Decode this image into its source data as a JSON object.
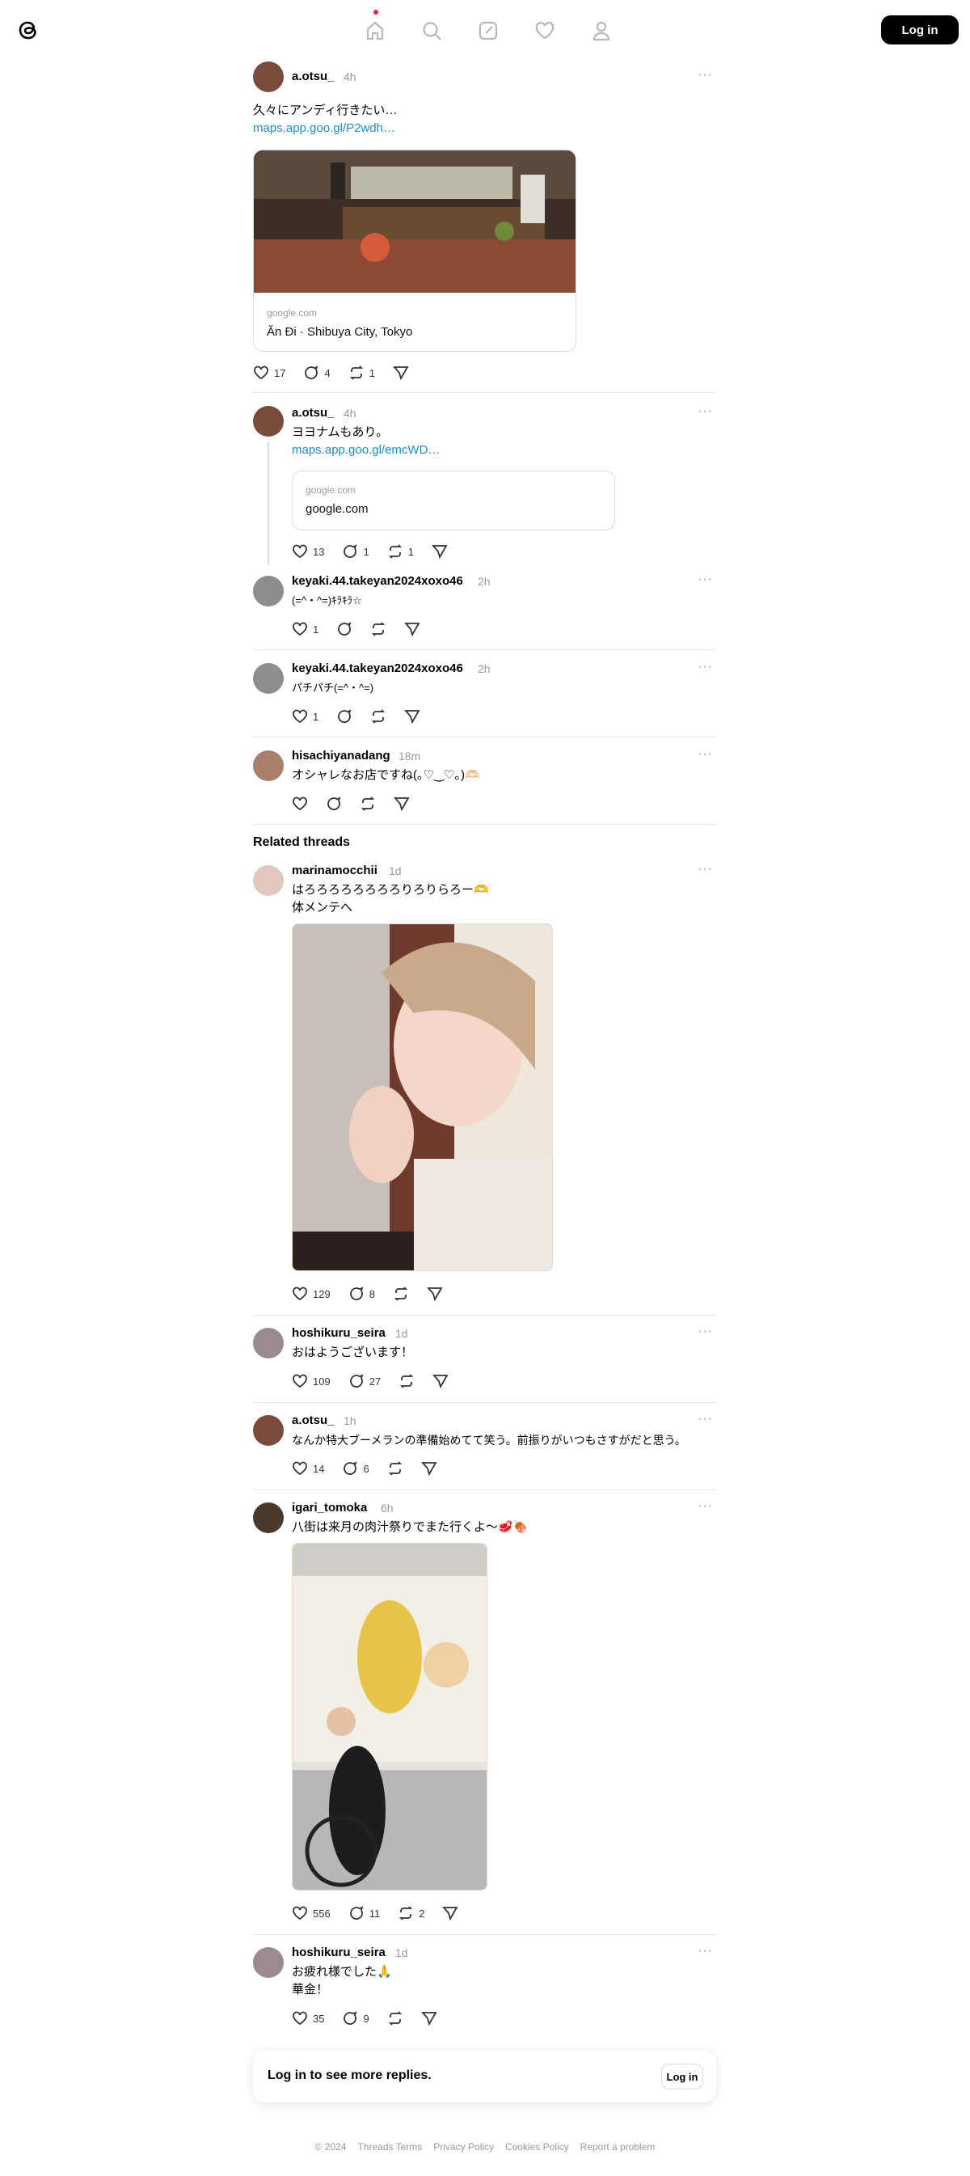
{
  "nav": {
    "login_label": "Log in"
  },
  "main_post": {
    "username": "a.otsu_",
    "time": "4h",
    "text": "久々にアンディ行きたい…",
    "link": "maps.app.goo.gl/P2wdh…",
    "card_domain": "google.com",
    "card_title": "Ăn Đi · Shibuya City, Tokyo",
    "likes": "17",
    "replies": "4",
    "reposts": "1"
  },
  "replies": [
    {
      "username": "a.otsu_",
      "time": "4h",
      "text": "ヨヨナムもあり。",
      "link": "maps.app.goo.gl/emcWD…",
      "card_domain": "google.com",
      "card_title": "google.com",
      "likes": "13",
      "replies": "1",
      "reposts": "1"
    },
    {
      "username": "keyaki.44.takeyan2024xoxo46",
      "time": "2h",
      "text": "(=^・^=)ｷﾗｷﾗ☆",
      "likes": "1",
      "replies": "",
      "reposts": ""
    },
    {
      "username": "keyaki.44.takeyan2024xoxo46",
      "time": "2h",
      "text": "パチパチ(=^・^=)",
      "likes": "1",
      "replies": "",
      "reposts": ""
    },
    {
      "username": "hisachiyanadang",
      "time": "18m",
      "text": "オシャレなお店ですね(｡♡‿♡｡)🫶🏻",
      "likes": "",
      "replies": "",
      "reposts": ""
    }
  ],
  "related_title": "Related threads",
  "related": [
    {
      "username": "marinamocchii",
      "time": "1d",
      "line1": "はろろろろろろろろりろりらろー🫶",
      "line2": "体メンテへ",
      "likes": "129",
      "replies": "8",
      "reposts": ""
    },
    {
      "username": "hoshikuru_seira",
      "time": "1d",
      "line1": "おはようございます！",
      "likes": "109",
      "replies": "27",
      "reposts": ""
    },
    {
      "username": "a.otsu_",
      "time": "1h",
      "line1": "なんか特大ブーメランの準備始めてて笑う。前振りがいつもさすがだと思う。",
      "likes": "14",
      "replies": "6",
      "reposts": ""
    },
    {
      "username": "igari_tomoka",
      "time": "6h",
      "line1": "八街は来月の肉汁祭りでまた行くよ〜🥩🍖",
      "likes": "556",
      "replies": "11",
      "reposts": "2"
    },
    {
      "username": "hoshikuru_seira",
      "time": "1d",
      "line1": "お疲れ様でした🙏",
      "line2": "華金！",
      "likes": "35",
      "replies": "9",
      "reposts": ""
    }
  ],
  "login_prompt": {
    "text": "Log in to see more replies.",
    "button": "Log in"
  },
  "footer": {
    "copyright": "© 2024",
    "links": [
      "Threads Terms",
      "Privacy Policy",
      "Cookies Policy",
      "Report a problem"
    ]
  }
}
